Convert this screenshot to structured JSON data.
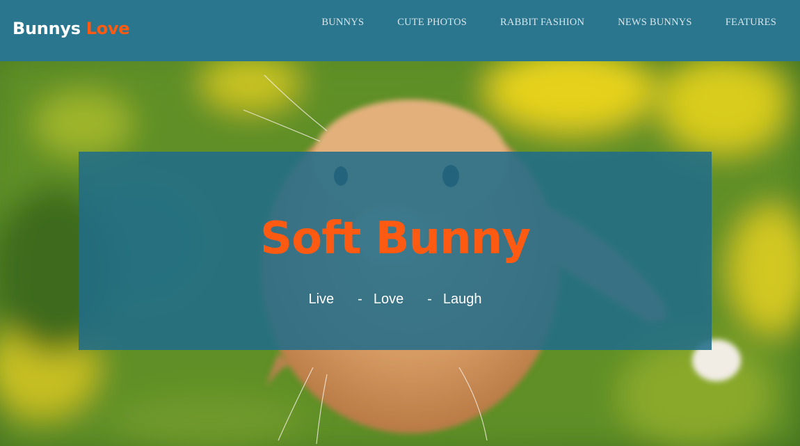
{
  "header": {
    "logo_primary": "Bunnys",
    "logo_accent": "Love",
    "nav": [
      {
        "label": "BUNNYS"
      },
      {
        "label": "CUTE PHOTOS"
      },
      {
        "label": "RABBIT FASHION"
      },
      {
        "label": "NEWS BUNNYS"
      },
      {
        "label": "FEATURES"
      }
    ]
  },
  "hero": {
    "title": "Soft Bunny",
    "tagline": {
      "word1": "Live",
      "sep1": "-",
      "word2": "Love",
      "sep2": "-",
      "word3": "Laugh"
    }
  },
  "colors": {
    "header_bg": "#29768e",
    "accent": "#ff5a12",
    "overlay": "#206c8a",
    "text_light": "#ffffff"
  }
}
